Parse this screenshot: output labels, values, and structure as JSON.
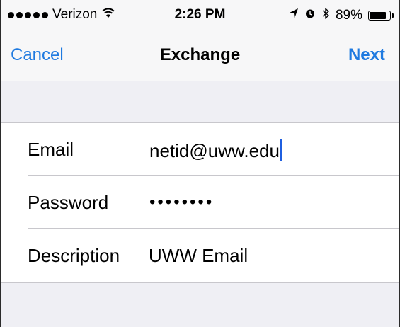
{
  "status_bar": {
    "carrier": "Verizon",
    "time": "2:26 PM",
    "battery_percent": "89%",
    "battery_level": 0.89,
    "icons": [
      "signal-dots",
      "wifi-icon",
      "location-arrow-icon",
      "alarm-clock-icon",
      "bluetooth-icon",
      "battery-icon"
    ]
  },
  "nav": {
    "cancel_label": "Cancel",
    "title": "Exchange",
    "next_label": "Next"
  },
  "form": {
    "email": {
      "label": "Email",
      "value": "netid@uww.edu"
    },
    "password": {
      "label": "Password",
      "value": "••••••••"
    },
    "description": {
      "label": "Description",
      "value": "UWW Email"
    }
  },
  "colors": {
    "accent": "#1f7ae0",
    "cursor": "#1f5fe0",
    "background": "#efeff4",
    "separator": "#c8c7cc"
  }
}
